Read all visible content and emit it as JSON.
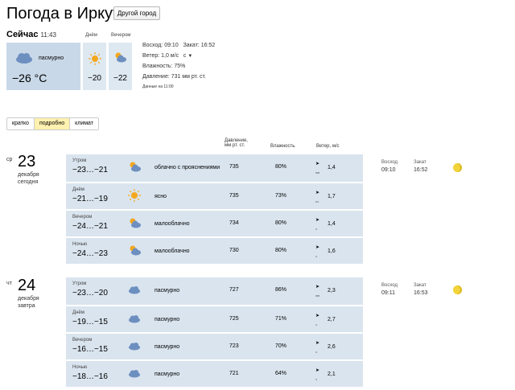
{
  "header": {
    "title": "Погода в Иркутске",
    "other_city_button": "Другой город"
  },
  "now": {
    "label": "Сейчас",
    "time": "11:43",
    "condition": "пасмурно",
    "temp": "−26 °C",
    "day_label": "Днём",
    "day_temp": "−20",
    "evening_label": "Вечером",
    "evening_temp": "−22",
    "sunrise": "Восход: 09:10",
    "sunset": "Закат: 16:52",
    "wind": "Ветер: 1,0 м/с",
    "wind_dir": "с",
    "humidity": "Влажность: 75%",
    "pressure": "Давление: 731 мм рт. ст.",
    "data_time": "Данные на 11:00"
  },
  "tabs": [
    {
      "label": "кратко",
      "active": false
    },
    {
      "label": "подробно",
      "active": true
    },
    {
      "label": "климат",
      "active": false
    }
  ],
  "columns": {
    "pressure": "Давление,",
    "pressure_unit": "мм рт. ст.",
    "humidity": "Влажность",
    "wind": "Ветер, м/с"
  },
  "days": [
    {
      "dow": "ср",
      "num": "23",
      "month": "декабря",
      "rel": "сегодня",
      "sunrise_label": "Восход",
      "sunrise": "09:10",
      "sunset_label": "Закат",
      "sunset": "16:52",
      "rows": [
        {
          "part": "Утром",
          "temp": "−23…−21",
          "icon": "cloud-sun-icon",
          "desc": "облачно с прояснениями",
          "pressure": "735",
          "humidity": "80%",
          "wind_arrow": "➤",
          "wind_dir": "юв",
          "wind": "1,4"
        },
        {
          "part": "Днём",
          "temp": "−21…−19",
          "icon": "sun-icon",
          "desc": "ясно",
          "pressure": "735",
          "humidity": "73%",
          "wind_arrow": "➤",
          "wind_dir": "сз",
          "wind": "1,7"
        },
        {
          "part": "Вечером",
          "temp": "−24…−21",
          "icon": "cloud-sun-icon",
          "desc": "малооблачно",
          "pressure": "734",
          "humidity": "80%",
          "wind_arrow": "➤",
          "wind_dir": "з",
          "wind": "1,4"
        },
        {
          "part": "Ночью",
          "temp": "−24…−23",
          "icon": "cloud-sun-icon",
          "desc": "малооблачно",
          "pressure": "730",
          "humidity": "80%",
          "wind_arrow": "➤",
          "wind_dir": "з",
          "wind": "1,6"
        }
      ]
    },
    {
      "dow": "чт",
      "num": "24",
      "month": "декабря",
      "rel": "завтра",
      "sunrise_label": "Восход",
      "sunrise": "09:11",
      "sunset_label": "Закат",
      "sunset": "16:53",
      "rows": [
        {
          "part": "Утром",
          "temp": "−23…−20",
          "icon": "cloud-icon",
          "desc": "пасмурно",
          "pressure": "727",
          "humidity": "86%",
          "wind_arrow": "➤",
          "wind_dir": "юв",
          "wind": "2,3"
        },
        {
          "part": "Днём",
          "temp": "−19…−15",
          "icon": "cloud-icon",
          "desc": "пасмурно",
          "pressure": "725",
          "humidity": "71%",
          "wind_arrow": "➤",
          "wind_dir": "з",
          "wind": "2,7"
        },
        {
          "part": "Вечером",
          "temp": "−16…−15",
          "icon": "cloud-icon",
          "desc": "пасмурно",
          "pressure": "723",
          "humidity": "70%",
          "wind_arrow": "➤",
          "wind_dir": "з",
          "wind": "2,6"
        },
        {
          "part": "Ночью",
          "temp": "−18…−16",
          "icon": "cloud-icon",
          "desc": "пасмурно",
          "pressure": "721",
          "humidity": "64%",
          "wind_arrow": "➤",
          "wind_dir": "з",
          "wind": "2,1"
        }
      ]
    }
  ]
}
